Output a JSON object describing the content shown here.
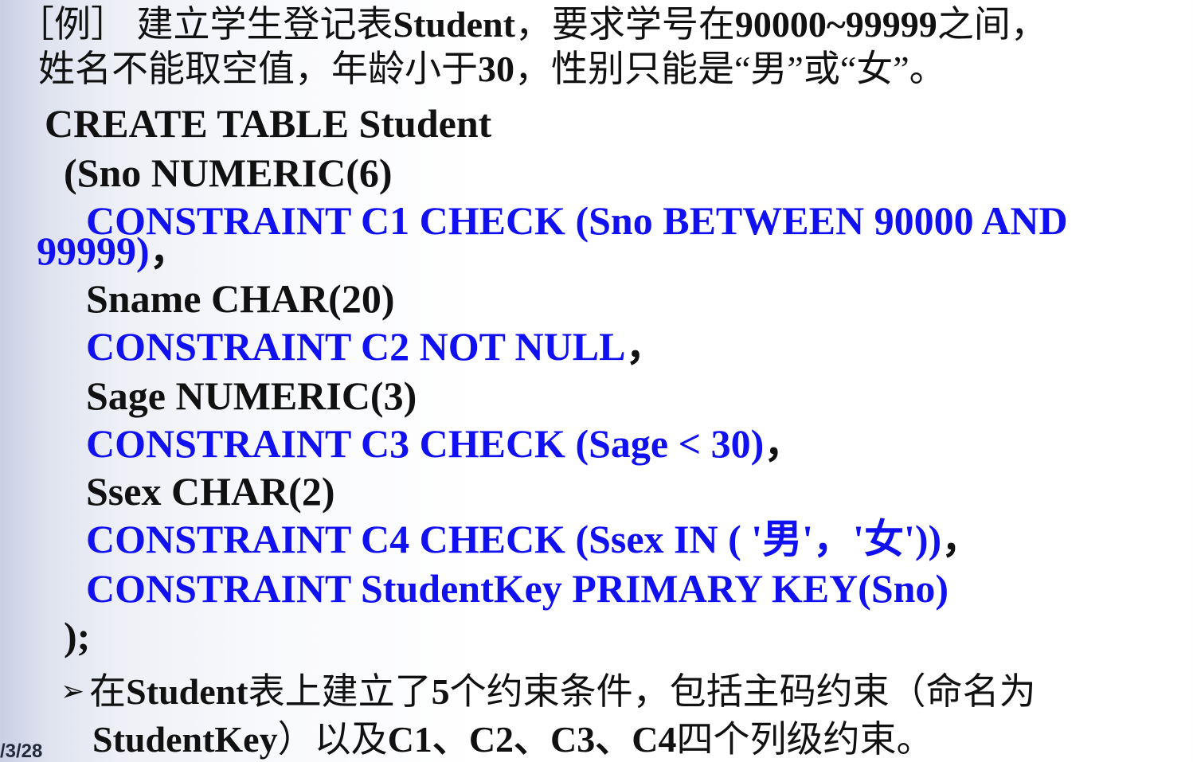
{
  "intro": {
    "line1_prefix": "［例］ 建立学生登记表",
    "line1_table": "Student",
    "line1_mid": "，要求学号在",
    "line1_range": "90000~99999",
    "line1_suffix": "之间，",
    "line2_prefix": "姓名不能取空值，年龄小于",
    "line2_age": "30",
    "line2_suffix": "，性别只能是“男”或“女”。"
  },
  "code": {
    "create": "CREATE TABLE Student",
    "sno": "(Sno  NUMERIC(6)",
    "c1_a": "CONSTRAINT C1 CHECK (Sno BETWEEN 90000 AND",
    "c1_b": "99999)",
    "c1_comma": "，",
    "sname": "Sname  CHAR(20)",
    "c2": "CONSTRAINT C2 NOT NULL",
    "c2_comma": "，",
    "sage": "Sage  NUMERIC(3)",
    "c3": "CONSTRAINT C3 CHECK (Sage < 30)",
    "c3_comma": "，",
    "ssex": "Ssex  CHAR(2)",
    "c4": "CONSTRAINT C4 CHECK (Ssex IN ( '男'，'女'))",
    "c4_comma": "，",
    "pk": "CONSTRAINT StudentKey PRIMARY KEY(Sno)",
    "end": ");"
  },
  "bullet": {
    "arrow_icon": "arrow-bullet-icon",
    "line1_prefix": "在",
    "line1_table": "Student",
    "line1_mid": "表上建立了",
    "line1_count": "5",
    "line1_suffix": "个约束条件，包括主码约束（命名为",
    "line2_key": "StudentKey",
    "line2_mid": "）以及",
    "line2_list": "C1、C2、C3、C4",
    "line2_suffix": "四个列级约束。"
  },
  "footer": {
    "date_fragment": "/3/28"
  },
  "colors": {
    "text": "#111111",
    "highlight_blue": "#1010f0"
  }
}
